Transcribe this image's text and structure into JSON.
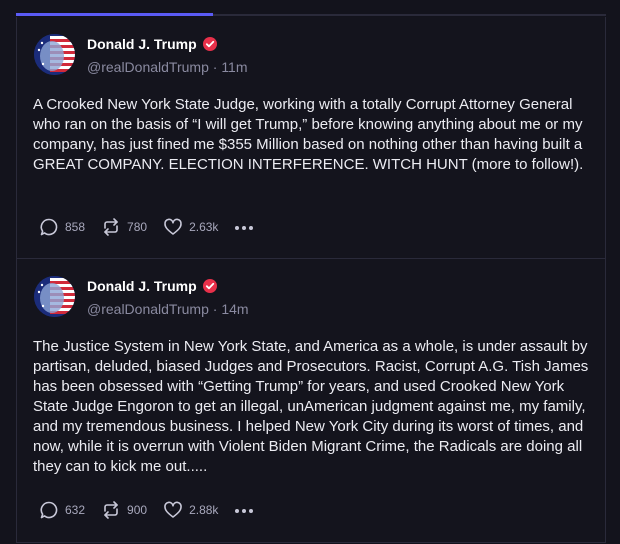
{
  "posts": [
    {
      "author": "Donald J. Trump",
      "handle": "@realDonaldTrump",
      "time": "11m",
      "text": "A Crooked New York State Judge, working with a totally Corrupt Attorney General who ran on the basis of “I will get Trump,” before knowing anything about me or my company, has just fined me $355 Million based on nothing other than having built a GREAT COMPANY. ELECTION INTERFERENCE. WITCH HUNT (more to follow!).",
      "replies": "858",
      "reposts": "780",
      "likes": "2.63k"
    },
    {
      "author": "Donald J. Trump",
      "handle": "@realDonaldTrump",
      "time": "14m",
      "text": "The Justice System in New York State, and America as a whole, is under assault by partisan, deluded, biased Judges and Prosecutors. Racist, Corrupt A.G. Tish James has been obsessed with “Getting Trump” for years, and used Crooked New York State Judge Engoron to get an illegal, unAmerican judgment against me, my family, and my tremendous business. I helped New York City during its worst of times, and now, while it is overrun with Violent Biden Migrant Crime, the Radicals are doing all they can to kick me out.....",
      "replies": "632",
      "reposts": "900",
      "likes": "2.88k"
    }
  ],
  "colors": {
    "accent": "#5b5bf5",
    "verified": "#e8304a",
    "background": "#13131c"
  },
  "icons": [
    "reply-icon",
    "repost-icon",
    "like-icon",
    "more-icon",
    "verified-badge-icon"
  ]
}
